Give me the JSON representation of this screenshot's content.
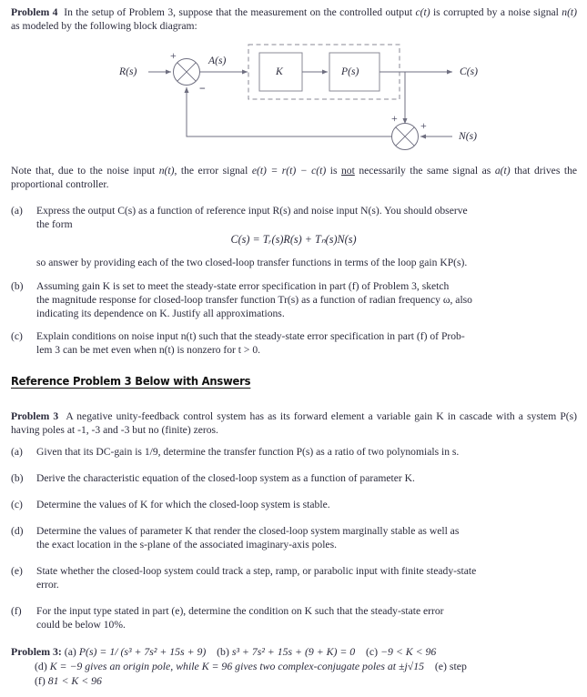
{
  "document": {
    "problem4": {
      "heading": "Problem 4",
      "intro_line1_a": "In the setup of Problem 3, suppose that the measurement on the controlled output ",
      "intro_c_t": "c(t)",
      "intro_line1_b": " is",
      "intro_line2_a": "corrupted by a noise signal ",
      "intro_n_t": "n(t)",
      "intro_line2_b": " as modeled by the following block diagram:",
      "note_a": "Note that, due to the noise input ",
      "note_n_t": "n(t)",
      "note_b": ", the error signal ",
      "note_eq": "e(t) = r(t) − c(t)",
      "note_c": " is ",
      "note_not": "not",
      "note_d": " necessarily the same signal",
      "note_line2_a": "as ",
      "note_a_t": "a(t)",
      "note_line2_b": " that drives the proportional controller.",
      "items": [
        {
          "label": "(a)",
          "line1": "Express the output C(s) as a function of reference input R(s) and noise input N(s). You should observe",
          "line2": "the form",
          "line3": "so answer by providing each of the two closed-loop transfer functions in terms of the loop gain KP(s)."
        },
        {
          "label": "(b)",
          "line1": "Assuming gain K is set to meet the steady-state error specification in part (f) of Problem 3, sketch",
          "line2": "the magnitude response for closed-loop transfer function Tr(s) as a function of radian frequency ω, also",
          "line3": "indicating its dependence on K. Justify all approximations."
        },
        {
          "label": "(c)",
          "line1": "Explain conditions on noise input n(t) such that the steady-state error specification in part (f) of Prob-",
          "line2": "lem 3 can be met even when n(t) is nonzero for t > 0."
        }
      ],
      "display_equation": "C(s) = Tᵣ(s)R(s) + Tₙ(s)N(s)"
    },
    "diagram": {
      "labels": {
        "input": "R(s)",
        "error": "A(s)",
        "gain_block": "K",
        "plant_block": "P(s)",
        "output": "C(s)",
        "noise": "N(s)"
      },
      "signs": {
        "sum1_plus": "+",
        "sum1_minus": "−",
        "sum2_plus_top": "+",
        "sum2_plus_right": "+"
      },
      "colors": {
        "line": "#6f6f80",
        "dashed_box": "#8a8a96",
        "block_border": "#8a8a96",
        "sign": "#3a3a55"
      }
    },
    "section_heading": "Reference Problem 3 Below with Answers",
    "problem3": {
      "heading": "Problem 3",
      "intro_line1": "A negative unity-feedback control system has as its forward element a variable gain K in",
      "intro_line2": "cascade with a system P(s) having poles at -1, -3 and -3 but no (finite) zeros.",
      "items": [
        {
          "label": "(a)",
          "line1": "Given that its DC-gain is 1/9, determine the transfer function P(s) as a ratio of two polynomials in s."
        },
        {
          "label": "(b)",
          "line1": "Derive the characteristic equation of the closed-loop system as a function of parameter K."
        },
        {
          "label": "(c)",
          "line1": "Determine the values of K for which the closed-loop system is stable."
        },
        {
          "label": "(d)",
          "line1": "Determine the values of parameter K that render the closed-loop system marginally stable as well as",
          "line2": "the exact location in the s-plane of the associated imaginary-axis poles."
        },
        {
          "label": "(e)",
          "line1": "State whether the closed-loop system could track a step, ramp, or parabolic input with finite steady-state",
          "line2": "error."
        },
        {
          "label": "(f)",
          "line1": "For the input type stated in part (e), determine the condition on K such that the steady-state error",
          "line2": "could be below 10%."
        }
      ]
    },
    "answers": {
      "heading": "Problem 3:",
      "a_label": "(a)",
      "a_value": "P(s) = 1/ (s³ + 7s² + 15s + 9)",
      "b_label": "(b)",
      "b_value": "s³ + 7s² + 15s + (9 + K) = 0",
      "c_label": "(c)",
      "c_value": "−9 < K < 96",
      "d_label": "(d)",
      "d_value": "K = −9 gives an origin pole, while K = 96 gives two complex-conjugate poles at ±j√15",
      "e_label": "(e)",
      "e_value": "step",
      "f_label": "(f)",
      "f_value": "81 < K < 96"
    }
  }
}
